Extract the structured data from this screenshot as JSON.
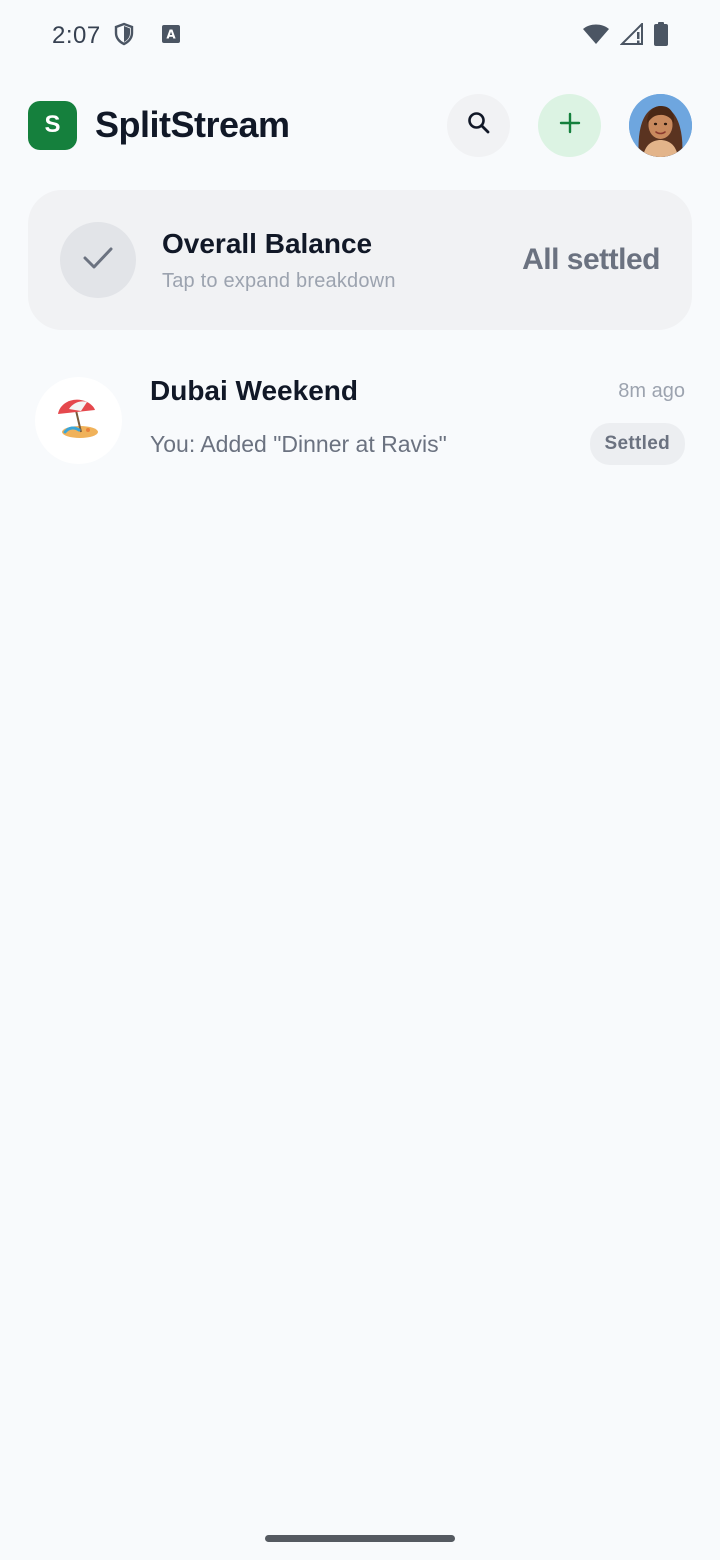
{
  "status_bar": {
    "time": "2:07",
    "icons": [
      "shield-icon",
      "text-a-icon",
      "wifi-icon",
      "signal-icon",
      "battery-icon"
    ]
  },
  "header": {
    "logo_letter": "S",
    "title": "SplitStream",
    "brand_color": "#15803d"
  },
  "balance_card": {
    "title": "Overall Balance",
    "subtitle": "Tap to expand breakdown",
    "status": "All settled"
  },
  "groups": [
    {
      "name": "Dubai Weekend",
      "last_activity": "You: Added \"Dinner at Ravis\"",
      "time": "8m ago",
      "badge": "Settled",
      "icon": "beach-umbrella-icon"
    }
  ]
}
